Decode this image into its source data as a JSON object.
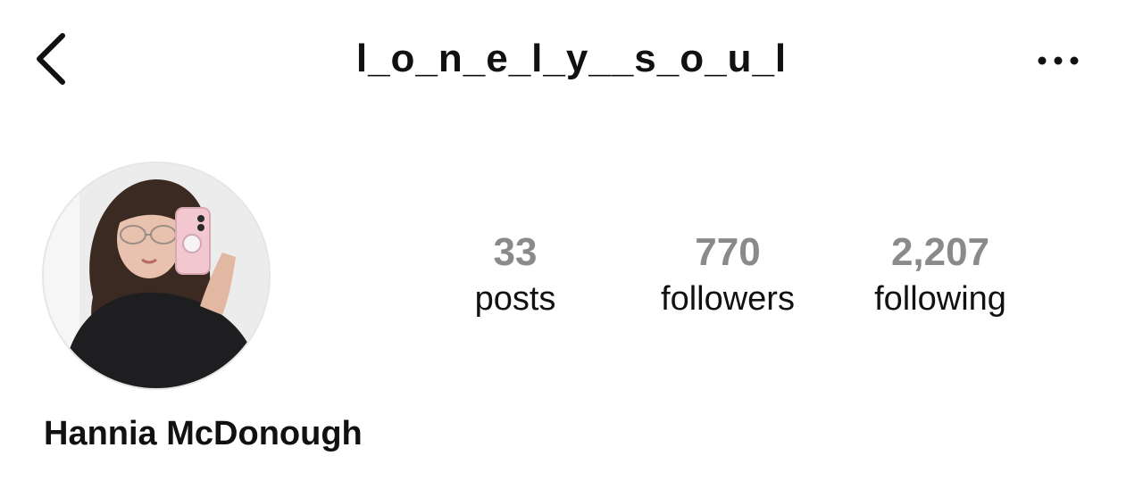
{
  "header": {
    "username": "l_o_n_e_l_y__s_o_u_l",
    "back_icon": "chevron-left-icon",
    "more_icon": "ellipsis-horizontal-icon"
  },
  "profile": {
    "display_name": "Hannia McDonough",
    "avatar": "profile-photo"
  },
  "stats": {
    "posts": {
      "value": "33",
      "label": "posts"
    },
    "followers": {
      "value": "770",
      "label": "followers"
    },
    "following": {
      "value": "2,207",
      "label": "following"
    }
  },
  "colors": {
    "background": "#ffffff",
    "text": "#111111",
    "stat_number": "#8a8a8a"
  }
}
